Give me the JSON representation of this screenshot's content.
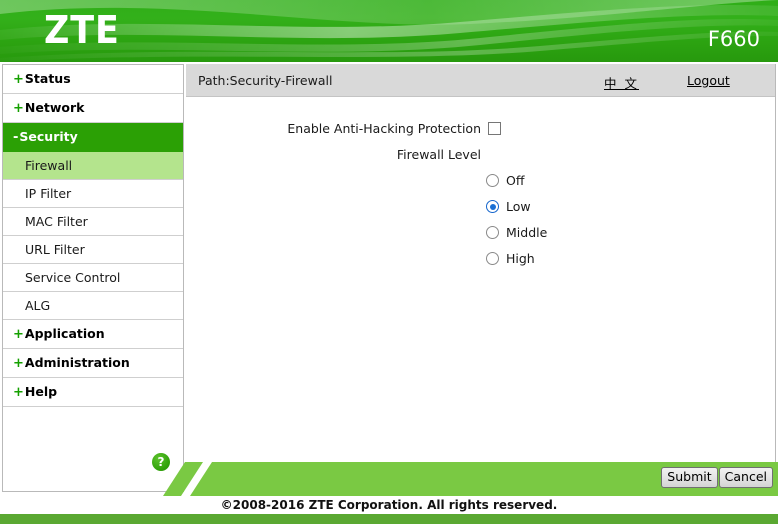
{
  "banner": {
    "logo_text": "ZTE",
    "model": "F660"
  },
  "sidebar": {
    "items": [
      {
        "label": "Status",
        "marker": "+",
        "type": "top",
        "state": "collapsed"
      },
      {
        "label": "Network",
        "marker": "+",
        "type": "top",
        "state": "collapsed"
      },
      {
        "label": "Security",
        "marker": "-",
        "type": "top",
        "state": "expanded"
      },
      {
        "label": "Firewall",
        "marker": "",
        "type": "sub",
        "state": "selected"
      },
      {
        "label": "IP Filter",
        "marker": "",
        "type": "sub",
        "state": "normal"
      },
      {
        "label": "MAC Filter",
        "marker": "",
        "type": "sub",
        "state": "normal"
      },
      {
        "label": "URL Filter",
        "marker": "",
        "type": "sub",
        "state": "normal"
      },
      {
        "label": "Service Control",
        "marker": "",
        "type": "sub",
        "state": "normal"
      },
      {
        "label": "ALG",
        "marker": "",
        "type": "sub",
        "state": "normal"
      },
      {
        "label": "Application",
        "marker": "+",
        "type": "top",
        "state": "collapsed"
      },
      {
        "label": "Administration",
        "marker": "+",
        "type": "top",
        "state": "collapsed"
      },
      {
        "label": "Help",
        "marker": "+",
        "type": "top",
        "state": "collapsed"
      }
    ],
    "help_icon": "?"
  },
  "path_bar": {
    "path": "Path:Security-Firewall",
    "language_link": "中 文",
    "logout_link": "Logout"
  },
  "form": {
    "anti_hacking_label": "Enable Anti-Hacking Protection",
    "anti_hacking_checked": false,
    "firewall_level_label": "Firewall Level",
    "firewall_level_selected": "Low",
    "firewall_levels": [
      {
        "label": "Off",
        "checked": false
      },
      {
        "label": "Low",
        "checked": true
      },
      {
        "label": "Middle",
        "checked": false
      },
      {
        "label": "High",
        "checked": false
      }
    ]
  },
  "footer": {
    "submit_label": "Submit",
    "cancel_label": "Cancel",
    "copyright": "©2008-2016 ZTE Corporation. All rights reserved."
  },
  "colors": {
    "banner_green": "#2da512",
    "accent_green": "#2ba005",
    "selected_green": "#b4e48d",
    "footer_band_green": "#7ac943",
    "bottom_bar_green": "#5aa832",
    "radio_blue": "#1a6fd4",
    "path_bar_gray": "#d9d9d9"
  }
}
